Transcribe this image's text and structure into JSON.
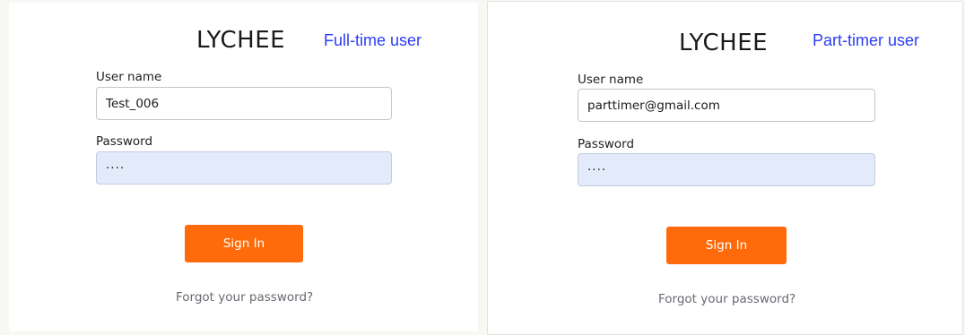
{
  "left_panel": {
    "logo": "LYCHEE",
    "role_label": "Full-time user",
    "username_label": "User name",
    "username_value": "Test_006",
    "password_label": "Password",
    "password_value": "····",
    "signin_label": "Sign In",
    "forgot_label": "Forgot your password?"
  },
  "right_panel": {
    "logo": "LYCHEE",
    "role_label": "Part-timer user",
    "username_label": "User name",
    "username_value": "parttimer@gmail.com",
    "password_label": "Password",
    "password_value": "····",
    "signin_label": "Sign In",
    "forgot_label": "Forgot your password?"
  },
  "colors": {
    "accent": "#ff6b0a",
    "role_label": "#2b3df5",
    "autofill_bg": "#e3ebfa",
    "link": "#666a70"
  }
}
